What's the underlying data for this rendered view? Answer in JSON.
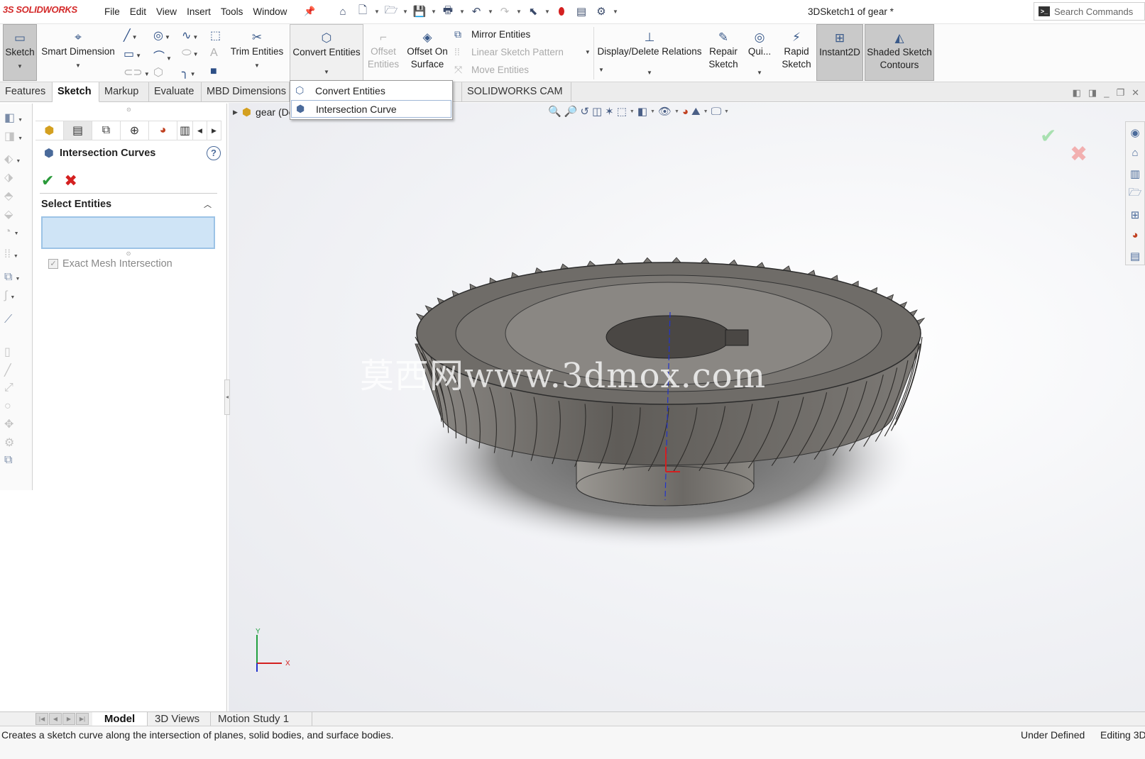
{
  "app": {
    "logo_prefix": "3S",
    "logo_text": "SOLIDWORKS",
    "document_title": "3DSketch1 of gear *"
  },
  "menu": [
    "File",
    "Edit",
    "View",
    "Insert",
    "Tools",
    "Window"
  ],
  "search": {
    "placeholder": "Search Commands"
  },
  "ribbon": {
    "sketch": "Sketch",
    "smart_dimension": "Smart Dimension",
    "trim_entities": "Trim Entities",
    "convert_entities": "Convert Entities",
    "offset_entities_1": "Offset",
    "offset_entities_2": "Entities",
    "offset_on_surface_1": "Offset On",
    "offset_on_surface_2": "Surface",
    "mirror_entities": "Mirror Entities",
    "linear_sketch_pattern": "Linear Sketch Pattern",
    "move_entities": "Move Entities",
    "display_delete_relations": "Display/Delete Relations",
    "repair_sketch_1": "Repair",
    "repair_sketch_2": "Sketch",
    "quick_snaps": "Qui...",
    "rapid_sketch_1": "Rapid",
    "rapid_sketch_2": "Sketch",
    "instant2d": "Instant2D",
    "shaded_sketch_contours_1": "Shaded Sketch",
    "shaded_sketch_contours_2": "Contours"
  },
  "tabs": [
    "Features",
    "Sketch",
    "Markup",
    "Evaluate",
    "MBD Dimensions",
    "SOLIDWORKS CAM"
  ],
  "active_tab": "Sketch",
  "dropdown": {
    "items": [
      "Convert Entities",
      "Intersection Curve"
    ],
    "highlighted": "Intersection Curve"
  },
  "property_manager": {
    "title": "Intersection Curves",
    "help": "?",
    "ok": "✔",
    "cancel": "✖",
    "group_title": "Select Entities",
    "checkbox_label": "Exact Mesh Intersection",
    "checkbox_checked": true
  },
  "tree": {
    "root": "gear (Default) <<Default>_Di..."
  },
  "watermark": "莫西网www.3dmox.com",
  "triad": {
    "x": "X",
    "y": "Y"
  },
  "bottom_tabs": [
    "Model",
    "3D Views",
    "Motion Study 1"
  ],
  "active_bottom_tab": "Model",
  "status": {
    "message": "Creates a sketch curve along the intersection of planes, solid bodies, and surface bodies.",
    "state": "Under Defined",
    "editing": "Editing 3D"
  },
  "colors": {
    "accent": "#d42a2a",
    "selection_box": "#cfe4f6",
    "ok_green": "#2a9a3a",
    "cancel_red": "#d42020",
    "gear_gray": "#6f6c68"
  }
}
